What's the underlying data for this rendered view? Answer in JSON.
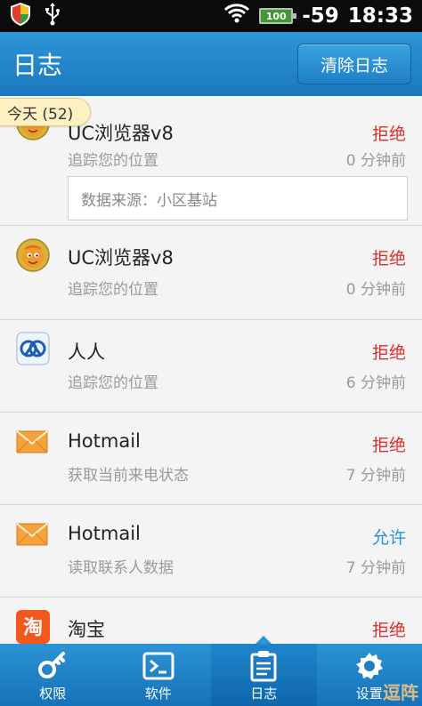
{
  "status_bar": {
    "signal": "-59",
    "time": "18:33",
    "battery": "100"
  },
  "header": {
    "title": "日志",
    "clear_button": "清除日志"
  },
  "section": {
    "label": "今天 (52)"
  },
  "rows": [
    {
      "name": "UC浏览器v8",
      "status": "拒绝",
      "desc": "追踪您的位置",
      "time": "0 分钟前",
      "source": "数据来源：小区基站"
    },
    {
      "name": "UC浏览器v8",
      "status": "拒绝",
      "desc": "追踪您的位置",
      "time": "0 分钟前"
    },
    {
      "name": "人人",
      "status": "拒绝",
      "desc": "追踪您的位置",
      "time": "6 分钟前"
    },
    {
      "name": "Hotmail",
      "status": "拒绝",
      "desc": "获取当前来电状态",
      "time": "7 分钟前"
    },
    {
      "name": "Hotmail",
      "status": "允许",
      "desc": "读取联系人数据",
      "time": "7 分钟前"
    },
    {
      "name": "淘宝",
      "status": "拒绝",
      "desc": "",
      "time": ""
    }
  ],
  "nav": {
    "items": [
      {
        "label": "权限"
      },
      {
        "label": "软件"
      },
      {
        "label": "日志"
      },
      {
        "label": "设置"
      }
    ],
    "watermark": "逗阵"
  },
  "colors": {
    "accent": "#1f7fc6",
    "deny": "#d8302e",
    "allow": "#2c8fd4"
  }
}
